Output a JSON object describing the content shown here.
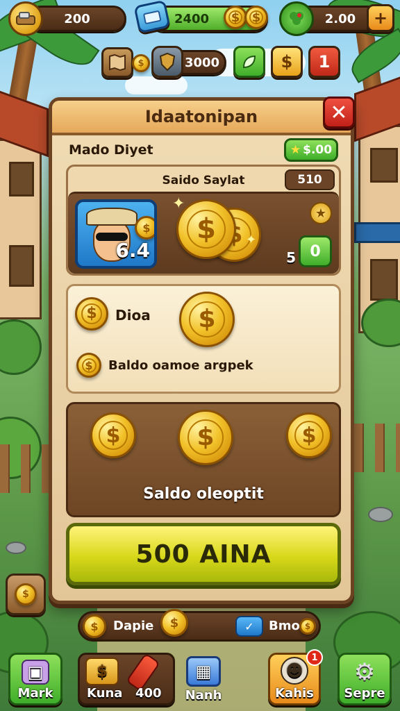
{
  "top_bar": {
    "gold_value": "200",
    "gems_value": "2400",
    "energy_value": "2.00",
    "plus_label": "+"
  },
  "second_bar": {
    "shield_value": "3000",
    "coin_btn_label": "$",
    "alert_btn_label": "1"
  },
  "panel": {
    "title": "Idaatonipan",
    "close_label": "✕",
    "subtitle": "Mado Diyet",
    "balance_chip": "$.00",
    "section1": {
      "heading": "Saido Saylat",
      "number": "510",
      "avatar_level": "6.4",
      "green_badge": "0",
      "green_badge_num": "5"
    },
    "section2": {
      "label_top": "Dioa",
      "label_bottom": "Baldo oamoe argpek"
    },
    "section3": {
      "label": "Saldo oleoptit"
    },
    "action_button": "500 AINA"
  },
  "bottom_bar": {
    "left_label": "Dapie",
    "right_label": "Bmo"
  },
  "nav": [
    {
      "label": "Mark"
    },
    {
      "label": "Kuna"
    },
    {
      "label": "400"
    },
    {
      "label": "Nanh"
    },
    {
      "label": "Kahis",
      "badge": "1"
    },
    {
      "label": "Sepre"
    }
  ],
  "colors": {
    "panel_bg": "#e3c698",
    "wood": "#6b4222",
    "action_yellow": "#e8e82a",
    "close_red": "#d02a1e",
    "green": "#3fae2a",
    "coin_gold": "#f2c22a"
  },
  "icons": [
    "gold-pile-icon",
    "gem-crate-icon",
    "coin-icon",
    "clover-icon",
    "plus-icon",
    "map-icon",
    "shield-icon",
    "close-icon",
    "star-icon",
    "chest-icon",
    "scroll-icon",
    "crate-icon",
    "skull-icon",
    "gear-icon",
    "check-icon"
  ]
}
